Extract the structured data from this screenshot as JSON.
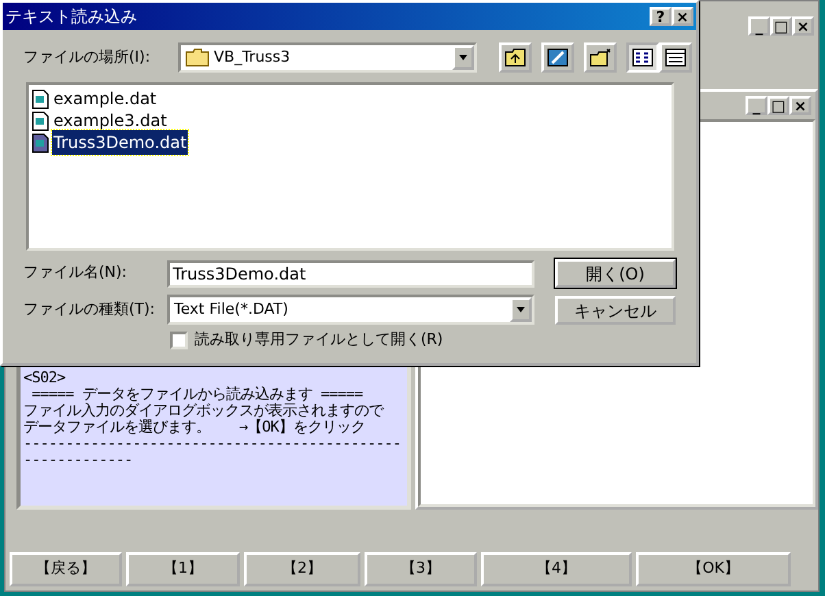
{
  "main_window": {
    "window_buttons": [
      "_",
      "□",
      "×"
    ],
    "log_panel": {
      "lines": [
        "<S02>",
        " ===== データをファイルから読み込みます =====",
        "ファイル入力のダイアログボックスが表示されますので",
        "データファイルを選びます。　　→【OK】をクリック",
        "----------------------------------------------------------"
      ]
    },
    "child_window": {
      "window_buttons": [
        "_",
        "□",
        "×"
      ]
    },
    "buttons": [
      "【戻る】",
      "【1】",
      "【2】",
      "【3】",
      "【4】",
      "【OK】"
    ]
  },
  "dialog": {
    "title": "テキスト読み込み",
    "title_buttons": [
      "?",
      "×"
    ],
    "look_in": {
      "label": "ファイルの場所(I):",
      "value": "VB_Truss3"
    },
    "view_toggles": [
      {
        "selected": true
      },
      {
        "selected": false
      }
    ],
    "files": [
      {
        "name": "example.dat",
        "selected": false
      },
      {
        "name": "example3.dat",
        "selected": false
      },
      {
        "name": "Truss3Demo.dat",
        "selected": true
      }
    ],
    "file_name": {
      "label": "ファイル名(N):",
      "value": "Truss3Demo.dat"
    },
    "file_type": {
      "label": "ファイルの種類(T):",
      "value": "Text File(*.DAT)"
    },
    "read_only": {
      "label": "読み取り専用ファイルとして開く(R)",
      "checked": false
    },
    "open_button": "開く(O)",
    "cancel_button": "キャンセル"
  }
}
